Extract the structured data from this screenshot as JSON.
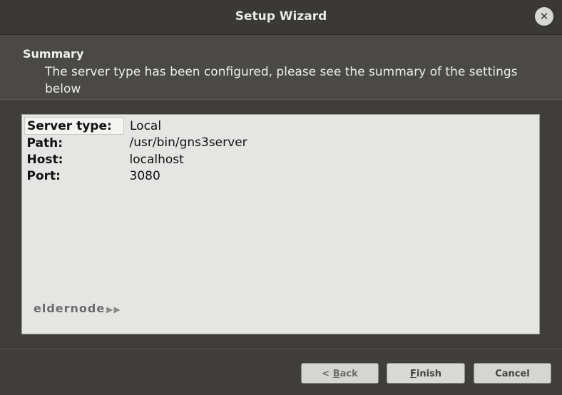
{
  "window": {
    "title": "Setup Wizard",
    "close_symbol": "✕"
  },
  "header": {
    "title": "Summary",
    "description": "The server type has been configured, please see the summary of the settings below"
  },
  "summary": {
    "rows": [
      {
        "key": "Server type:",
        "value": "Local"
      },
      {
        "key": "Path:",
        "value": "/usr/bin/gns3server"
      },
      {
        "key": "Host:",
        "value": "localhost"
      },
      {
        "key": "Port:",
        "value": "3080"
      }
    ]
  },
  "watermark": {
    "text": "eldernode",
    "arrows": "▶▶"
  },
  "buttons": {
    "back_prefix": "< ",
    "back_mnemonic": "B",
    "back_rest": "ack",
    "finish_mnemonic": "F",
    "finish_rest": "inish",
    "cancel_label": "Cancel"
  },
  "icons": {
    "close": "close-icon"
  },
  "colors": {
    "titlebar": "#3a3936",
    "header": "#4a4946",
    "content_bg": "#e5e5e3",
    "button_bg": "#d5d5d2"
  }
}
